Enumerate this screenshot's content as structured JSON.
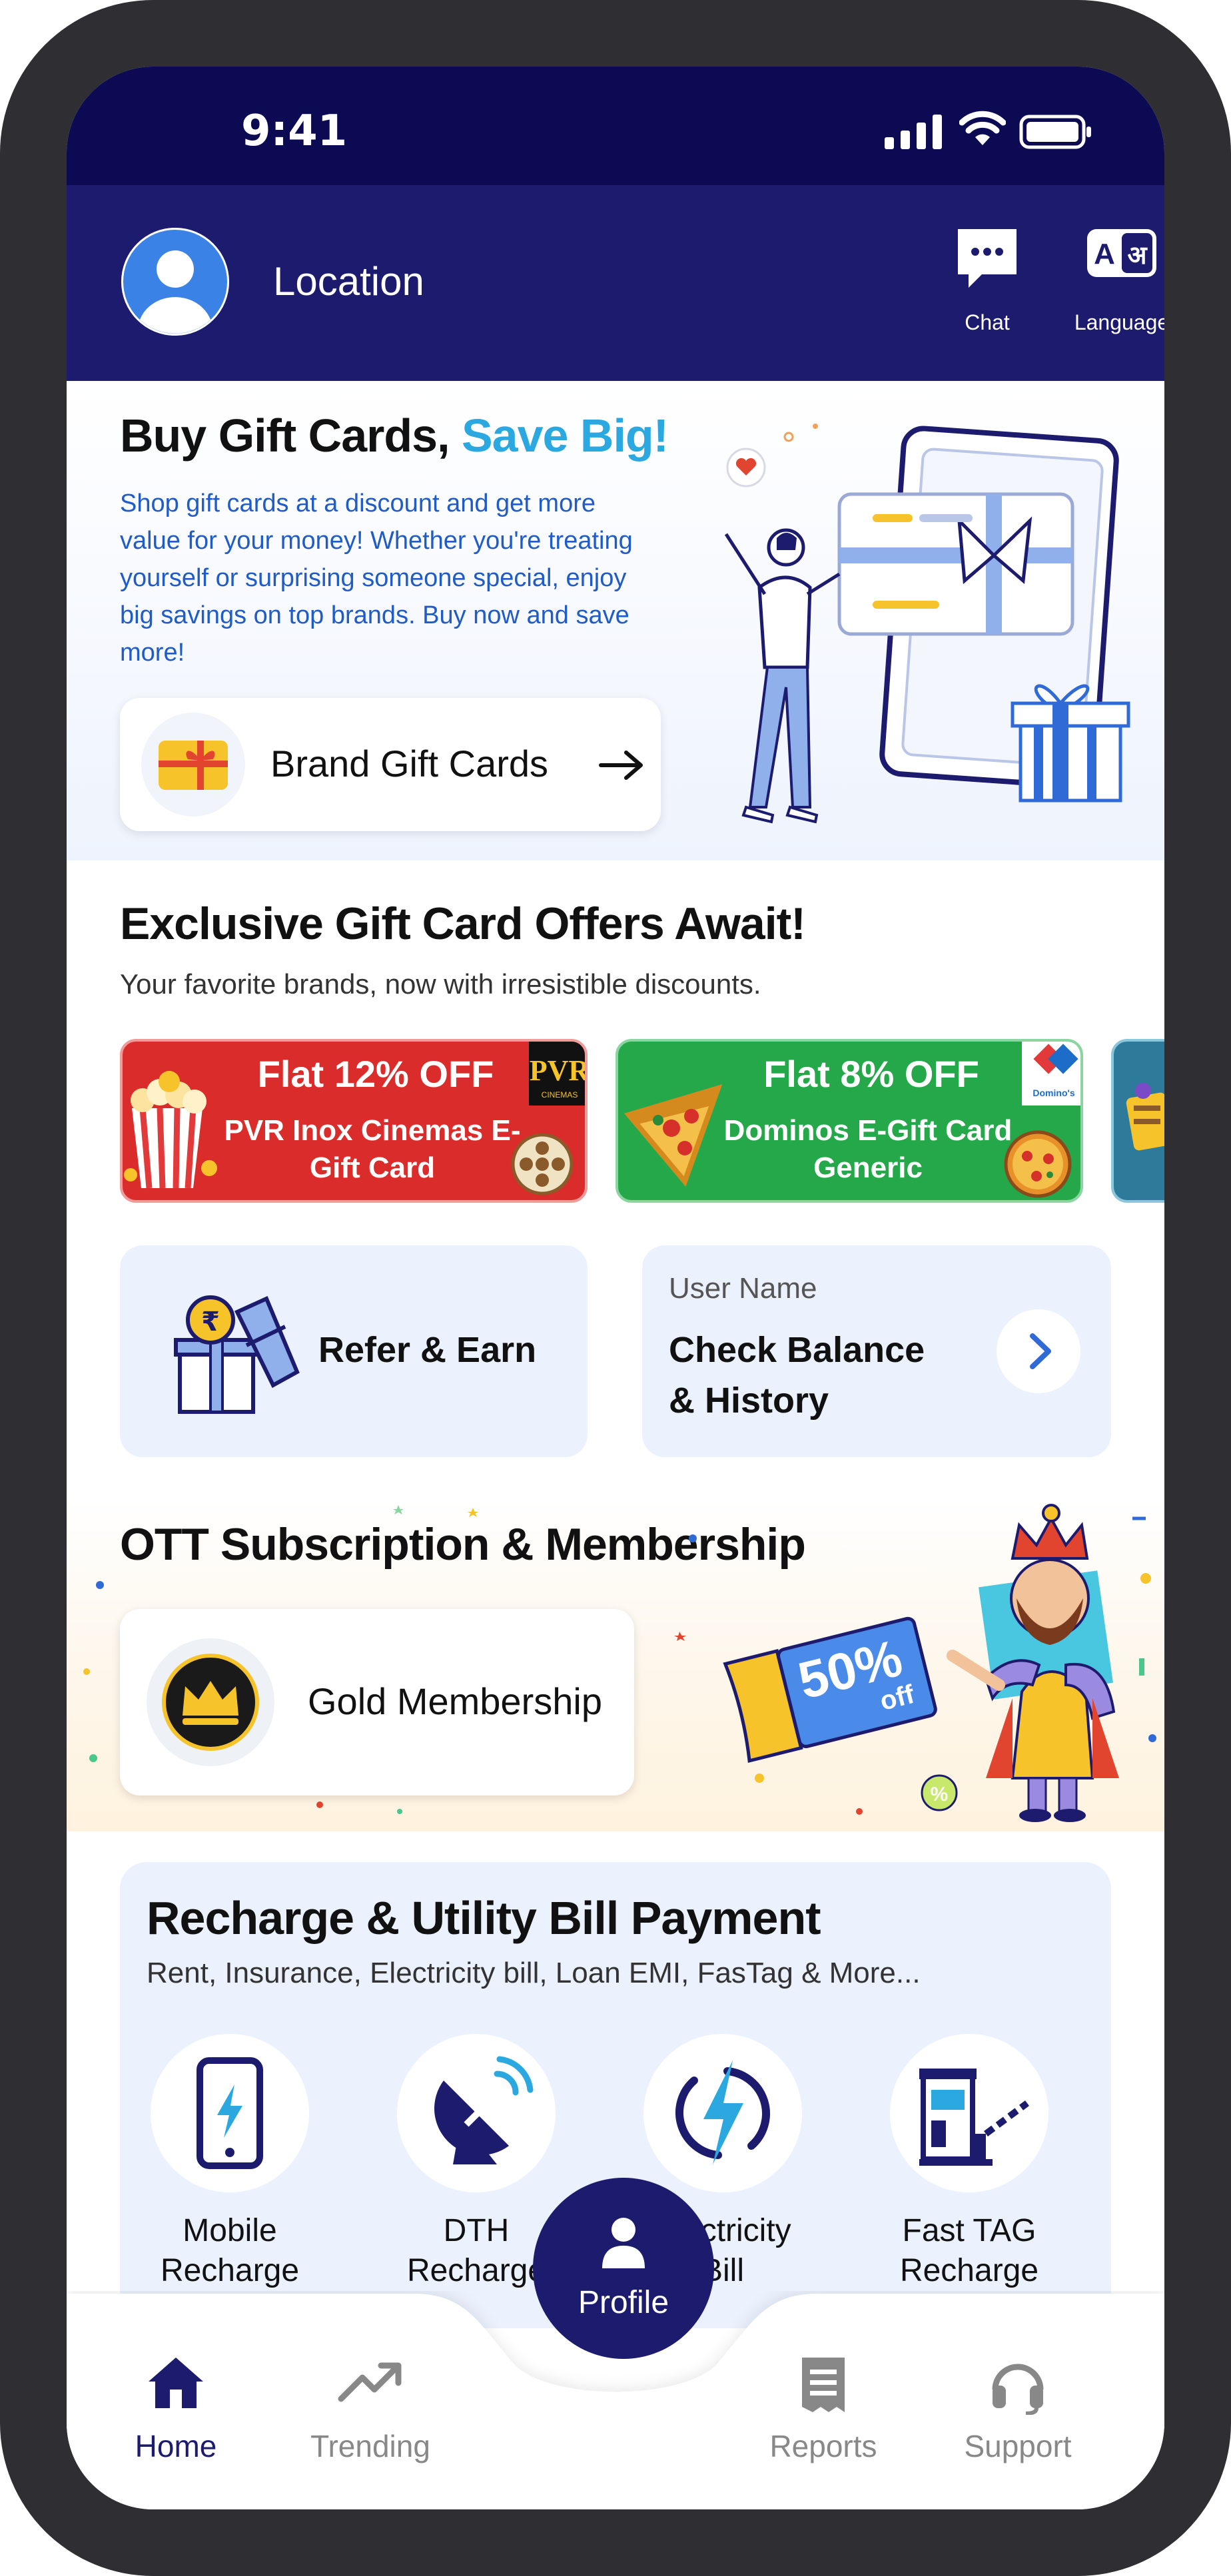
{
  "status_bar": {
    "time": "9:41"
  },
  "header": {
    "location": "Location",
    "chat_label": "Chat",
    "language_label": "Language"
  },
  "hero": {
    "title_part1": "Buy Gift Cards,",
    "title_part2": "Save Big!",
    "description": "Shop gift cards at a discount and get more value for your money! Whether you're treating yourself or surprising someone special, enjoy big savings on top brands. Buy now and save more!",
    "button_label": "Brand Gift Cards"
  },
  "offers": {
    "title": "Exclusive Gift Card Offers Await!",
    "subtitle": "Your favorite brands, now with irresistible discounts.",
    "items": [
      {
        "headline": "Flat 12% OFF",
        "name": "PVR Inox Cinemas E-Gift Card",
        "brand": "PVR"
      },
      {
        "headline": "Flat 8% OFF",
        "name": "Dominos E-Gift Card Generic",
        "brand": "Domino's Pizza"
      }
    ]
  },
  "refer": {
    "label": "Refer & Earn"
  },
  "balance": {
    "user_name": "User Name",
    "line1": "Check Balance",
    "line2": "& History"
  },
  "ott": {
    "title": "OTT Subscription & Membership",
    "button_label": "Gold Membership",
    "promo_value": "50%",
    "promo_suffix": "off"
  },
  "recharge": {
    "title": "Recharge & Utility Bill Payment",
    "subtitle": "Rent, Insurance, Electricity bill, Loan EMI, FasTag & More...",
    "services": [
      {
        "line1": "Mobile",
        "line2": "Recharge"
      },
      {
        "line1": "DTH",
        "line2": "Recharge"
      },
      {
        "line1": "Electricity",
        "line2": "Bill"
      },
      {
        "line1": "Fast TAG",
        "line2": "Recharge"
      }
    ]
  },
  "nav": {
    "home": "Home",
    "trending": "Trending",
    "profile": "Profile",
    "reports": "Reports",
    "support": "Support"
  },
  "colors": {
    "brand_navy": "#1d1b6e",
    "status_navy": "#0b0a52",
    "accent_blue": "#2ba8e0",
    "offer_red": "#db2c2c",
    "offer_green": "#25a84a"
  }
}
